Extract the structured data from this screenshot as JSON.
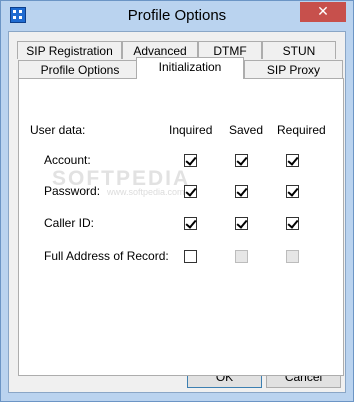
{
  "window": {
    "title": "Profile Options",
    "close_glyph": "✕"
  },
  "tabs": {
    "row1": [
      "SIP Registration",
      "Advanced",
      "DTMF",
      "STUN"
    ],
    "row2": [
      "Profile Options",
      "Initialization",
      "SIP Proxy"
    ],
    "selected": "Initialization"
  },
  "panel": {
    "section_label": "User data:",
    "columns": [
      "Inquired",
      "Saved",
      "Required"
    ],
    "rows": [
      {
        "label": "Account:",
        "inquired": true,
        "saved": true,
        "required": true,
        "enabled": true
      },
      {
        "label": "Password:",
        "inquired": true,
        "saved": true,
        "required": true,
        "enabled": true
      },
      {
        "label": "Caller ID:",
        "inquired": true,
        "saved": true,
        "required": true,
        "enabled": true
      },
      {
        "label": "Full Address of Record:",
        "inquired": false,
        "saved": false,
        "required": false,
        "enabled": false
      }
    ],
    "watermark": "SOFTPEDIA",
    "watermark_url": "www.softpedia.com"
  },
  "buttons": {
    "ok": "OK",
    "cancel": "Cancel"
  },
  "colors": {
    "frame": "#bad3ef",
    "close": "#c7504c",
    "face": "#f0f0f0"
  }
}
